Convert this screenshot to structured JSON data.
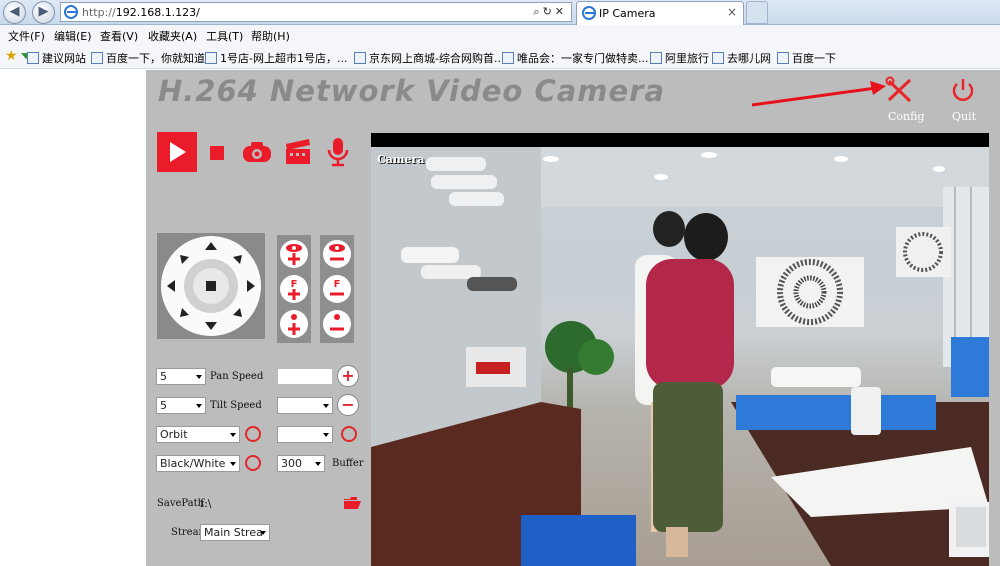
{
  "browser": {
    "url_protocol": "http://",
    "url_host": "192.168.1.123/",
    "tab_title": "IP Camera",
    "tab_close": "×",
    "back_glyph": "◀",
    "forward_glyph": "▶"
  },
  "menu": [
    "文件(F)",
    "编辑(E)",
    "查看(V)",
    "收藏夹(A)",
    "工具(T)",
    "帮助(H)"
  ],
  "favorites": [
    "建议网站",
    "百度一下，你就知道",
    "1号店-网上超市1号店，...",
    "京东网上商城-综合网购首...",
    "唯品会：一家专门做特卖...",
    "阿里旅行",
    "去哪儿网",
    "百度一下"
  ],
  "camera": {
    "title": "H.264 Network Video Camera",
    "config_label": "Config",
    "quit_label": "Quit",
    "overlay_text": "Camera",
    "pan_speed_value": "5",
    "pan_speed_label": "Pan Speed",
    "tilt_speed_value": "5",
    "tilt_speed_label": "Tilt Speed",
    "orbit_value": "Orbit",
    "color_mode_value": "Black/White",
    "buffer_value": "300",
    "buffer_label": "Buffer",
    "savepath_label": "SavePath",
    "savepath_value": "f:\\",
    "stream_label": "Stream",
    "stream_value": "Main Strea",
    "plus_glyph": "+",
    "minus_glyph": "−"
  },
  "colors": {
    "accent": "#ea1c2a",
    "page_bg": "#bcbcbc",
    "title_gray": "#8a8a8a"
  },
  "icons": [
    "play-icon",
    "stop-icon",
    "snapshot-icon",
    "record-icon",
    "microphone-icon",
    "config-icon",
    "quit-icon",
    "folder-icon"
  ]
}
